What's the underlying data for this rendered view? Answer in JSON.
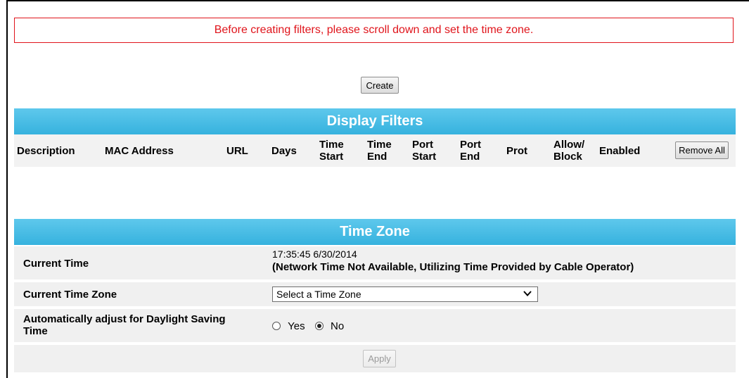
{
  "notice": {
    "text": "Before creating filters, please scroll down and set the time zone.",
    "color": "#e0141b"
  },
  "create_button": {
    "label": "Create"
  },
  "display_filters": {
    "title": "Display Filters",
    "columns": [
      {
        "line1": "Description",
        "line2": ""
      },
      {
        "line1": "MAC Address",
        "line2": ""
      },
      {
        "line1": "URL",
        "line2": ""
      },
      {
        "line1": "Days",
        "line2": ""
      },
      {
        "line1": "Time",
        "line2": "Start"
      },
      {
        "line1": "Time",
        "line2": "End"
      },
      {
        "line1": "Port",
        "line2": "Start"
      },
      {
        "line1": "Port",
        "line2": "End"
      },
      {
        "line1": "Prot",
        "line2": ""
      },
      {
        "line1": "Allow/",
        "line2": "Block"
      },
      {
        "line1": "Enabled",
        "line2": ""
      }
    ],
    "remove_all_label": "Remove All"
  },
  "time_zone": {
    "title": "Time Zone",
    "current_time_label": "Current Time",
    "current_time_value": "17:35:45 6/30/2014",
    "current_time_note": "(Network Time Not Available, Utilizing Time Provided by Cable Operator)",
    "zone_label": "Current Time Zone",
    "zone_select_value": "Select a Time Zone",
    "dst_label_line1": "Automatically adjust for Daylight Saving",
    "dst_label_line2": "Time",
    "dst_yes": "Yes",
    "dst_no": "No",
    "dst_selected": "No",
    "apply_label": "Apply"
  },
  "colors": {
    "header_blue": "#36b2de",
    "row_gray": "#f0f0f0"
  }
}
